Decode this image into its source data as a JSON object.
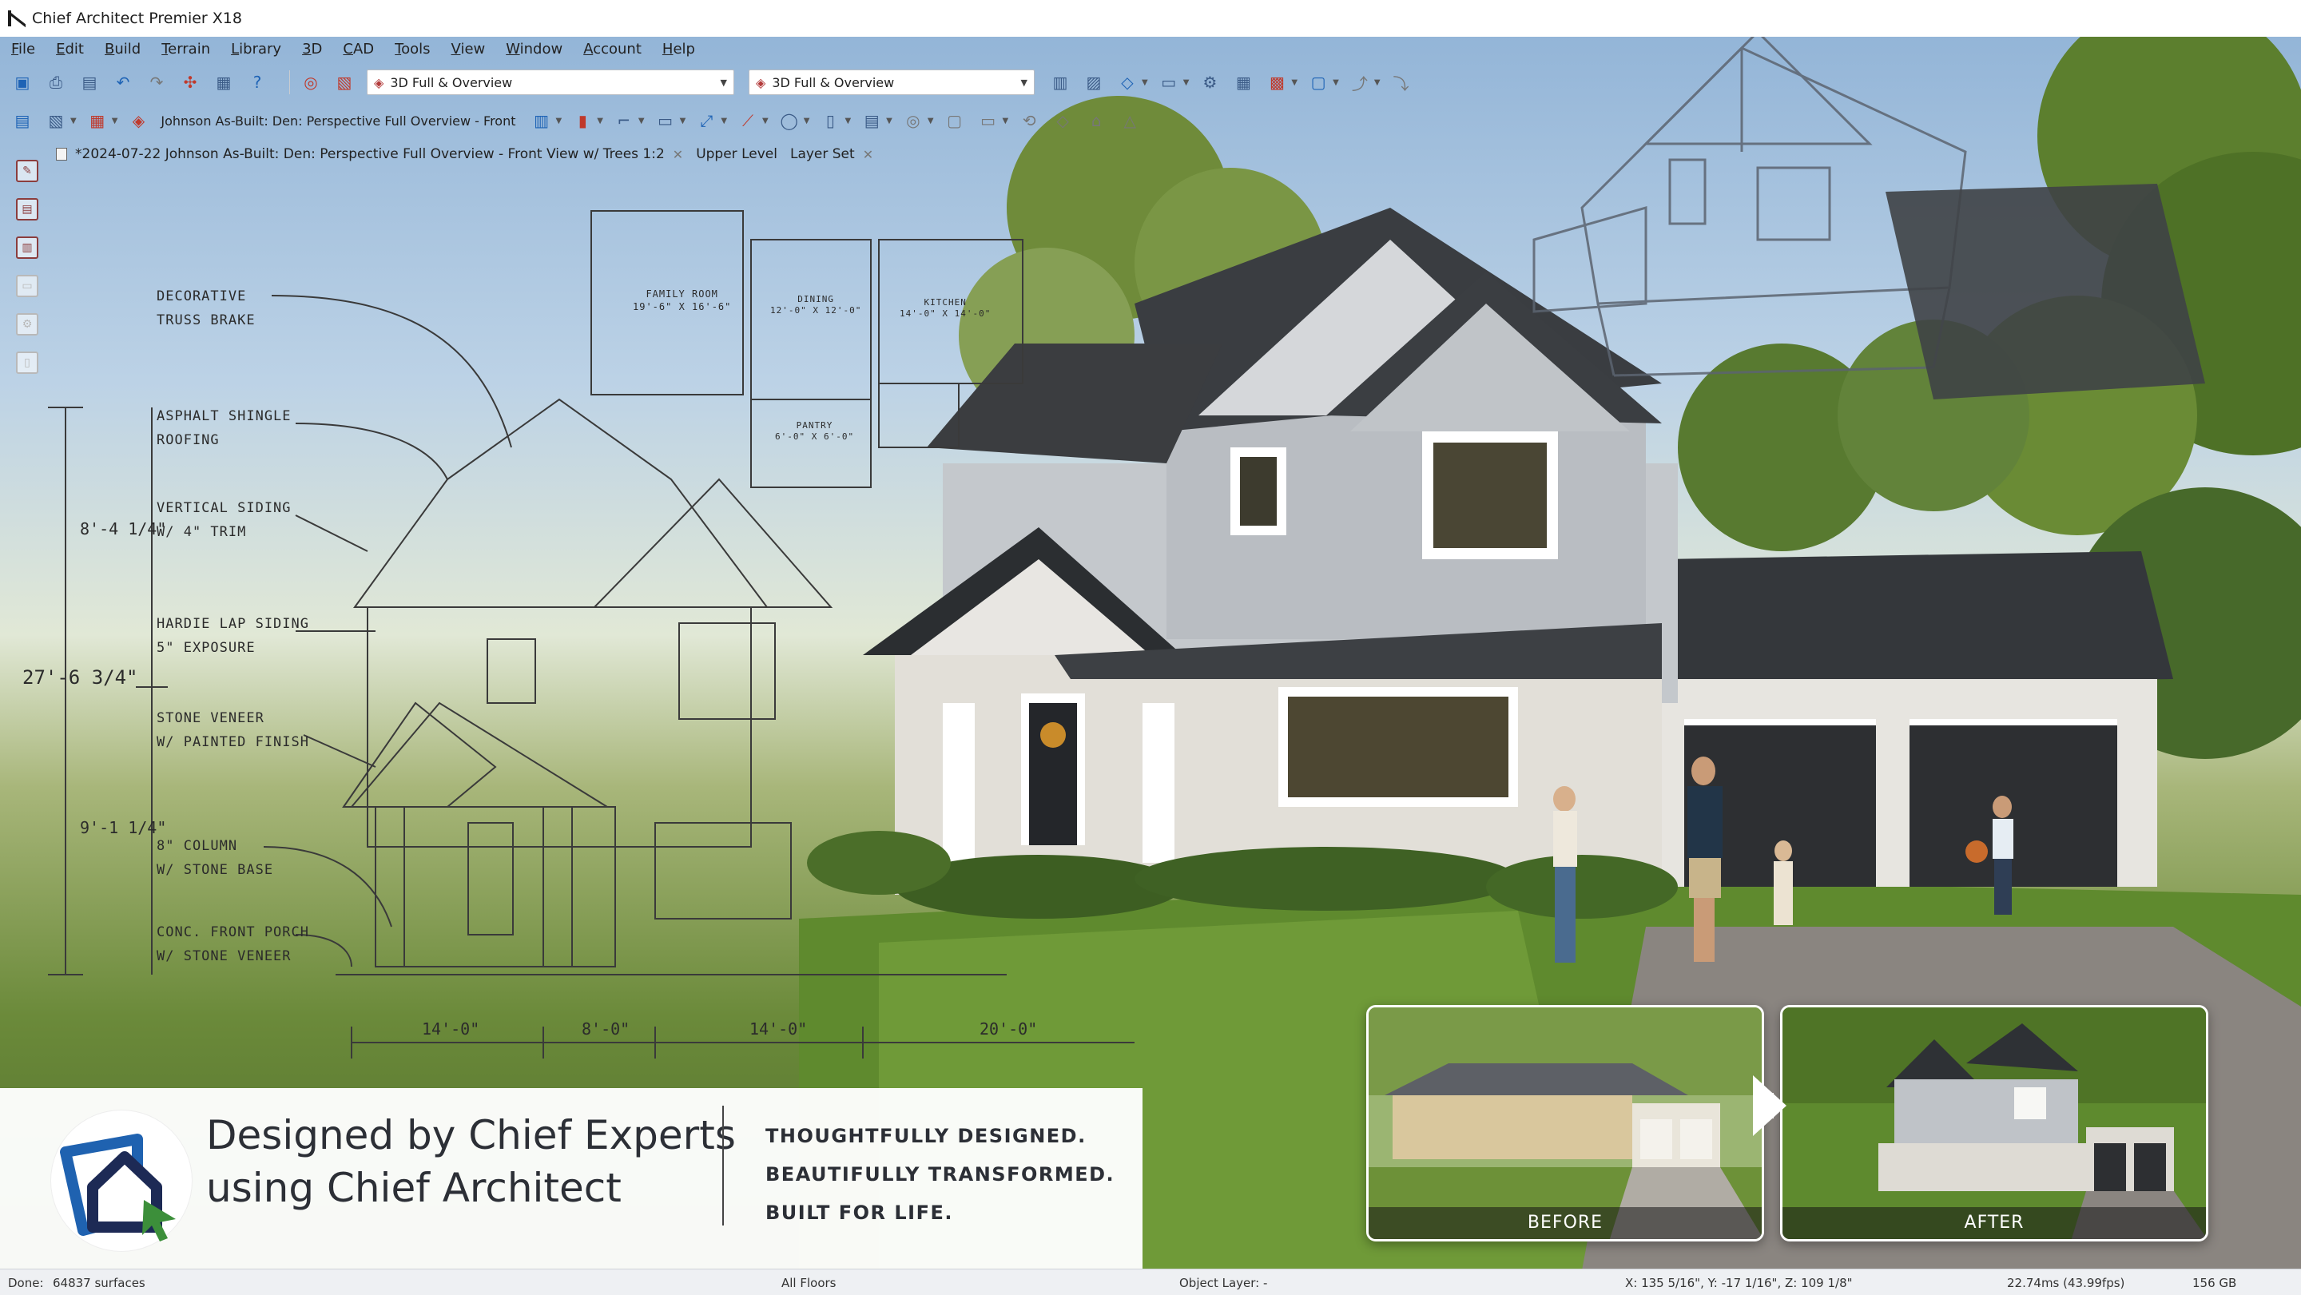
{
  "window": {
    "title": "Chief Architect Premier X18"
  },
  "menu": [
    "File",
    "Edit",
    "Build",
    "Terrain",
    "Library",
    "3D",
    "CAD",
    "Tools",
    "View",
    "Window",
    "Account",
    "Help"
  ],
  "toolbar": {
    "view_combo_1": "3D Full & Overview",
    "view_combo_2": "3D Full & Overview",
    "active_view_label": "Johnson As-Built: Den: Perspective Full Overview - Front"
  },
  "tabs": [
    {
      "label": "*2024-07-22 Johnson As-Built: Den: Perspective Full Overview - Front View w/ Trees 1:2"
    },
    {
      "label": "Upper Level"
    },
    {
      "label": "Layer Set"
    }
  ],
  "sketch": {
    "notes": [
      {
        "l1": "DECORATIVE",
        "l2": "TRUSS BRAKE"
      },
      {
        "l1": "ASPHALT SHINGLE",
        "l2": "ROOFING"
      },
      {
        "l1": "VERTICAL SIDING",
        "l2": "W/ 4\" TRIM"
      },
      {
        "l1": "HARDIE LAP SIDING",
        "l2": "5\" EXPOSURE"
      },
      {
        "l1": "STONE VENEER",
        "l2": "W/ PAINTED FINISH"
      },
      {
        "l1": "8\" COLUMN",
        "l2": "W/ STONE BASE"
      },
      {
        "l1": "CONC. FRONT PORCH",
        "l2": "W/ STONE VENEER"
      }
    ],
    "dims": {
      "upper": "8'-4 1/4\"",
      "total": "27'-6 3/4\"",
      "lower": "9'-1 1/4\"",
      "w1": "14'-0\"",
      "w2": "8'-0\"",
      "w3": "14'-0\"",
      "w4": "20'-0\""
    },
    "plan_rooms": [
      {
        "name": "FAMILY ROOM",
        "size": "19'-6\" x 16'-6\""
      },
      {
        "name": "DINING",
        "size": "12'-0\" x 12'-0\""
      },
      {
        "name": "KITCHEN",
        "size": "14'-0\" x 14'-0\""
      },
      {
        "name": "PANTRY",
        "size": "6'-0\" x 6'-0\""
      }
    ]
  },
  "banner": {
    "line1": "Designed by Chief Experts",
    "line2": "using Chief Architect",
    "tag1": "THOUGHTFULLY DESIGNED.",
    "tag2": "BEAUTIFULLY TRANSFORMED.",
    "tag3": "BUILT FOR LIFE."
  },
  "compare": {
    "before": "BEFORE",
    "after": "AFTER"
  },
  "status": {
    "done": "Done:",
    "surfaces": "64837 surfaces",
    "floors": "All Floors",
    "object_layer": "Object Layer: -",
    "coords": "X: 135 5/16\", Y: -17 1/16\", Z: 109 1/8\"",
    "fps": "22.74ms (43.99fps)",
    "memory": "156 GB"
  },
  "colors": {
    "siding": "#c9ccd0",
    "trim": "#2b2f33",
    "roof": "#3b3d40",
    "stone": "#e4e1da",
    "brand_blue": "#1f62b0",
    "brand_navy": "#1d2a55"
  }
}
